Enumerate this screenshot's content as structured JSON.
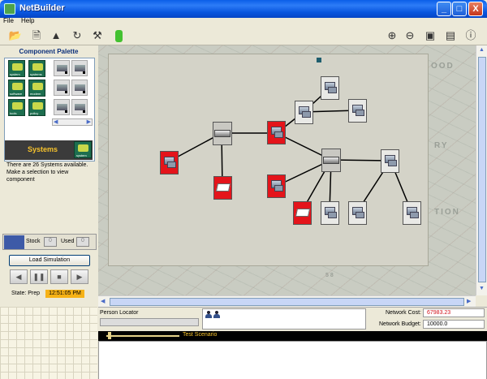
{
  "window": {
    "title": "NetBuilder",
    "buttons": [
      "_",
      "□",
      "X"
    ]
  },
  "menu": {
    "items": [
      "File",
      "Help"
    ]
  },
  "toolbar": {
    "left_icons": [
      "open-icon",
      "new-file-icon",
      "stamp-icon",
      "refresh-icon",
      "tools-icon",
      "battery-icon"
    ],
    "right_icons": [
      "zoom-in-icon",
      "zoom-out-icon",
      "save-icon",
      "print-icon",
      "help-icon"
    ]
  },
  "palette": {
    "title": "Component Palette",
    "categories": [
      "system",
      "systems module",
      "software",
      "modem",
      "tools",
      "policy"
    ],
    "selected_label": "Systems",
    "selected_icon_label": "system",
    "description": "There are 26 Systems available. Make a selection to view component"
  },
  "stock": {
    "stock_label": "Stock",
    "stock_value": "0",
    "used_label": "Used",
    "used_value": "0"
  },
  "simulation": {
    "load_label": "Load Simulation",
    "controls": [
      "rewind",
      "pause",
      "stop",
      "play"
    ],
    "control_glyphs": [
      "◀",
      "❚❚",
      "■",
      "▶"
    ],
    "state_label": "State: Prep",
    "state_time": "12:51:05 PM"
  },
  "map": {
    "labels": [
      "OOD",
      "RY",
      "TION",
      "58"
    ]
  },
  "bottom": {
    "person_locator_label": "Person Locator",
    "network_cost_label": "Network Cost:",
    "network_cost_value": "67983.23",
    "network_budget_label": "Network Budget:",
    "network_budget_value": "10000.0",
    "scenario_label": "Test Scenario"
  },
  "colors": {
    "titlebar": "#0a5ee8",
    "accent_red": "#e4141b",
    "state_time_bg": "#f6b217",
    "scenario_text": "#f6c22c"
  }
}
